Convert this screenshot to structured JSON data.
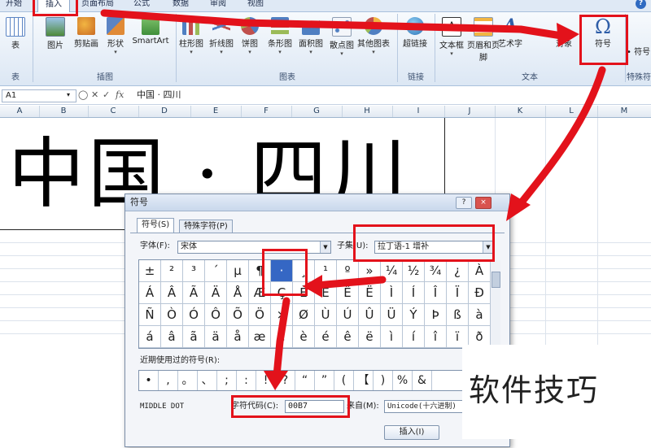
{
  "tabs": [
    {
      "label": "开始",
      "x": 2
    },
    {
      "label": "插入",
      "active": true
    },
    {
      "label": "页面布局"
    },
    {
      "label": "公式"
    },
    {
      "label": "数据"
    },
    {
      "label": "审阅"
    },
    {
      "label": "视图"
    }
  ],
  "help_label": "?",
  "ribbon": {
    "table_label": "表",
    "picture_label": "图片",
    "clipart_label": "剪贴画",
    "shapes_label": "形状",
    "smartart_label": "SmartArt",
    "column_label": "柱形图",
    "line_label": "折线图",
    "pie_label": "饼图",
    "bar_label": "条形图",
    "area_label": "面积图",
    "scatter_label": "散点图",
    "other_label": "其他图表",
    "hyperlink_label": "超链接",
    "textbox_label": "文本框",
    "headerfooter_label": "页眉和页脚",
    "wordart_label": "艺术字",
    "object_label": "对象",
    "symbol_label": "符号",
    "symbol_glyph": "Ω",
    "special_label": "• 符号",
    "groups": {
      "table": "表",
      "illustrations": "插图",
      "charts": "图表",
      "links": "链接",
      "text": "文本",
      "special": "特殊符号"
    }
  },
  "formula_bar": {
    "name_box": "A1",
    "content": "中国 · 四川",
    "fx": "fx"
  },
  "columns": [
    "A",
    "B",
    "C",
    "D",
    "E",
    "F",
    "G",
    "H",
    "I",
    "J",
    "K",
    "L",
    "M"
  ],
  "cell_text": "中国 · 四川",
  "dialog": {
    "title": "符号",
    "help": "?",
    "close": "×",
    "tab_symbols": "符号(S)",
    "tab_special": "特殊字符(P)",
    "font_label": "字体(F):",
    "font_value": "宋体",
    "subset_label": "子集(U):",
    "subset_value": "拉丁语-1 增补",
    "symbols": [
      [
        "±",
        "²",
        "³",
        "´",
        "µ",
        "¶",
        "·",
        "¸",
        "¹",
        "º",
        "»",
        "¼",
        "½",
        "¾",
        "¿",
        "À"
      ],
      [
        "Á",
        "Â",
        "Ã",
        "Ä",
        "Å",
        "Æ",
        "Ç",
        "È",
        "É",
        "Ê",
        "Ë",
        "Ì",
        "Í",
        "Î",
        "Ï",
        "Ð"
      ],
      [
        "Ñ",
        "Ò",
        "Ó",
        "Ô",
        "Õ",
        "Ö",
        "×",
        "Ø",
        "Ù",
        "Ú",
        "Û",
        "Ü",
        "Ý",
        "Þ",
        "ß",
        "à"
      ],
      [
        "á",
        "â",
        "ã",
        "ä",
        "å",
        "æ",
        "ç",
        "è",
        "é",
        "ê",
        "ë",
        "ì",
        "í",
        "î",
        "ï",
        "ð"
      ]
    ],
    "recent_label": "近期使用过的符号(R):",
    "recent": [
      "•",
      ",",
      "。",
      "、",
      ";",
      ":",
      "!",
      "?",
      "“",
      "”",
      "(",
      "【",
      ")",
      "%",
      "&"
    ],
    "char_name": "MIDDLE DOT",
    "char_code_label": "字符代码(C):",
    "char_code_value": "00B7",
    "from_label": "来自(M):",
    "from_value": "Unicode(十六进制)",
    "insert_button": "插入(I)"
  },
  "watermark": "软件技巧",
  "annotation_color": "#e3121b"
}
